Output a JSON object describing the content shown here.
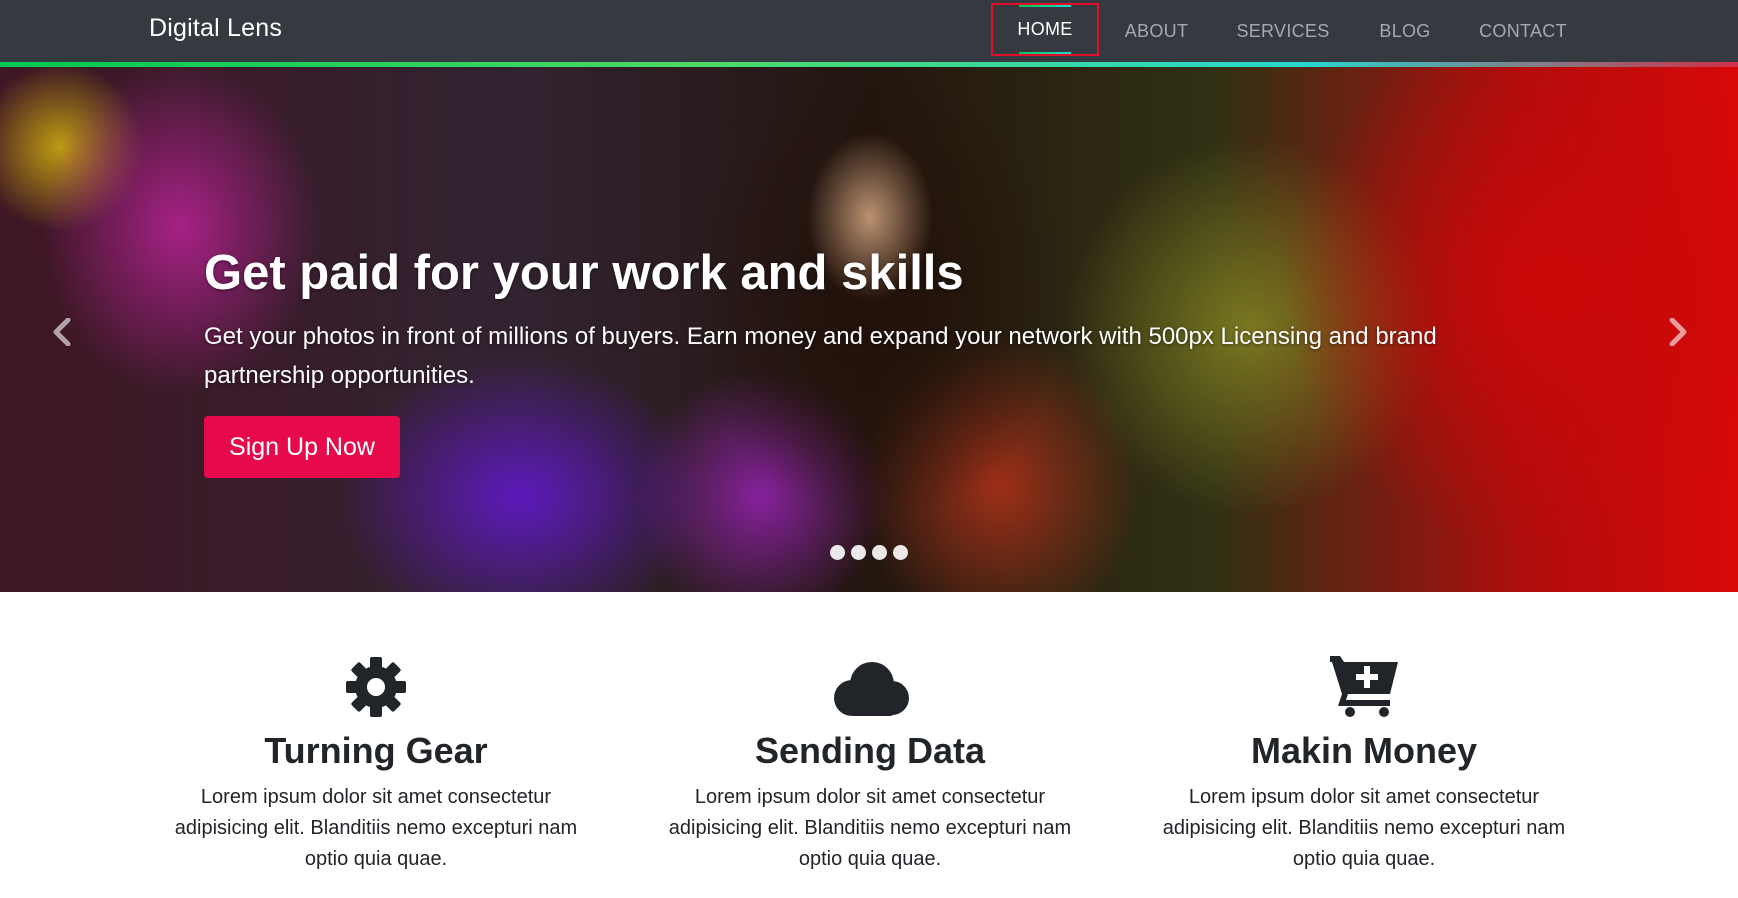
{
  "navbar": {
    "brand": "Digital Lens",
    "items": [
      {
        "label": "HOME",
        "active": true
      },
      {
        "label": "ABOUT",
        "active": false
      },
      {
        "label": "SERVICES",
        "active": false
      },
      {
        "label": "BLOG",
        "active": false
      },
      {
        "label": "CONTACT",
        "active": false
      }
    ]
  },
  "hero": {
    "title": "Get paid for your work and skills",
    "text": "Get your photos in front of millions of buyers. Earn money and expand your network with 500px Licensing and brand partnership opportunities.",
    "button_label": "Sign Up Now",
    "slide_count": 4,
    "accent_color": "#e60a4a"
  },
  "features": [
    {
      "icon": "gear-icon",
      "title": "Turning Gear",
      "text": "Lorem ipsum dolor sit amet consectetur adipisicing elit. Blanditiis nemo excepturi nam optio quia quae."
    },
    {
      "icon": "cloud-icon",
      "title": "Sending Data",
      "text": "Lorem ipsum dolor sit amet consectetur adipisicing elit. Blanditiis nemo excepturi nam optio quia quae."
    },
    {
      "icon": "cart-plus-icon",
      "title": "Makin Money",
      "text": "Lorem ipsum dolor sit amet consectetur adipisicing elit. Blanditiis nemo excepturi nam optio quia quae."
    }
  ]
}
